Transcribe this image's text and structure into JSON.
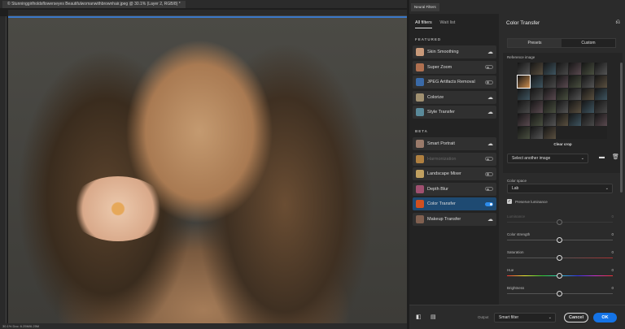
{
  "document": {
    "tab_title": "© Stunninggirlholdsflowerseyes Beautifulwomanwithbrownhair.jpeg @ 30.1% (Layer 2, RGB/8) *",
    "status": "30.1%   Doc: 6.25M/6.25M"
  },
  "panel": {
    "title": "Neural Filters",
    "tabs": [
      "All filters",
      "Wait list"
    ],
    "featured_label": "FEATURED",
    "beta_label": "BETA",
    "featured": [
      {
        "label": "Skin Smoothing",
        "control": "cloud",
        "color": "#c99a7a"
      },
      {
        "label": "Super Zoom",
        "control": "toggle",
        "color": "#b07050"
      },
      {
        "label": "JPEG Artifacts Removal",
        "control": "toggle",
        "color": "#3a6aa8"
      },
      {
        "label": "Colorize",
        "control": "cloud",
        "color": "#a09070"
      },
      {
        "label": "Style Transfer",
        "control": "cloud",
        "color": "#5a8a9a"
      }
    ],
    "beta": [
      {
        "label": "Smart Portrait",
        "control": "cloud",
        "color": "#9a7a6a"
      },
      {
        "label": "Harmonization",
        "control": "toggle",
        "color": "#b08040",
        "disabled": true
      },
      {
        "label": "Landscape Mixer",
        "control": "toggle",
        "color": "#c0a060"
      },
      {
        "label": "Depth Blur",
        "control": "toggle",
        "color": "#a05070"
      },
      {
        "label": "Color Transfer",
        "control": "toggle-on",
        "color": "#d05020",
        "selected": true
      },
      {
        "label": "Makeup Transfer",
        "control": "cloud",
        "color": "#806050"
      }
    ],
    "color_transfer": {
      "title": "Color Transfer",
      "presets_label": "Presets",
      "custom_label": "Custom",
      "reference_label": "Reference image",
      "clear_crop": "Clear crop",
      "select_image": "Select another image",
      "color_space_label": "Color space",
      "color_space_value": "Lab",
      "preserve_luminance": "Preserve luminance",
      "sliders": [
        {
          "label": "Luminance",
          "value": "0",
          "disabled": true
        },
        {
          "label": "Color strength",
          "value": "0"
        },
        {
          "label": "Saturation",
          "value": "0"
        },
        {
          "label": "Hue",
          "value": "0"
        },
        {
          "label": "Brightness",
          "value": "0"
        }
      ]
    },
    "footer": {
      "output_label": "Output",
      "output_value": "Smart filter",
      "cancel": "Cancel",
      "ok": "OK"
    }
  }
}
